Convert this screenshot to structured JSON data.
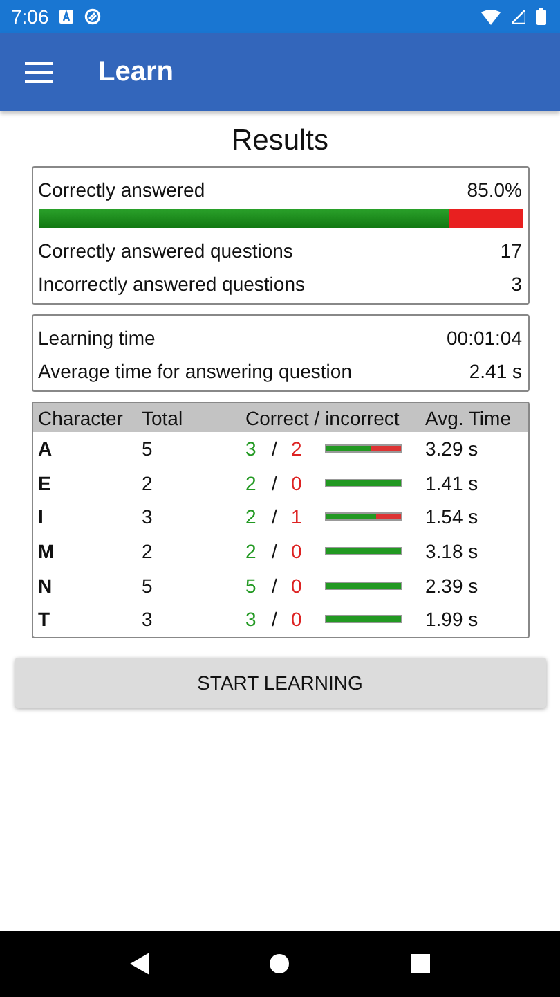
{
  "status_bar": {
    "time": "7:06"
  },
  "app_bar": {
    "title": "Learn"
  },
  "title": "Results",
  "summary": {
    "label": "Correctly answered",
    "value": "85.0%",
    "level": 0.85,
    "rows": [
      {
        "label": "Correctly answered questions",
        "value": "17"
      },
      {
        "label": "Incorrectly answered questions",
        "value": "3"
      }
    ]
  },
  "timing": [
    {
      "label": "Learning time",
      "value": "00:01:04"
    },
    {
      "label": "Average time for answering question",
      "value": "2.41 s"
    }
  ],
  "table": {
    "columns": [
      "Character",
      "Total",
      "Correct / incorrect",
      "Avg. Time"
    ],
    "rows": [
      {
        "character": "A",
        "total": "5",
        "correct": "3",
        "separator": "/",
        "incorrect": "2",
        "level": 0.6,
        "time": "3.29 s"
      },
      {
        "character": "E",
        "total": "2",
        "correct": "2",
        "separator": "/",
        "incorrect": "0",
        "level": 1,
        "time": "1.41 s"
      },
      {
        "character": "I",
        "total": "3",
        "correct": "2",
        "separator": "/",
        "incorrect": "1",
        "level": 0.67,
        "time": "1.54 s"
      },
      {
        "character": "M",
        "total": "2",
        "correct": "2",
        "separator": "/",
        "incorrect": "0",
        "level": 1,
        "time": "3.18 s"
      },
      {
        "character": "N",
        "total": "5",
        "correct": "5",
        "separator": "/",
        "incorrect": "0",
        "level": 1,
        "time": "2.39 s"
      },
      {
        "character": "T",
        "total": "3",
        "correct": "3",
        "separator": "/",
        "incorrect": "0",
        "level": 1,
        "time": "1.99 s"
      }
    ]
  },
  "button": "START LEARNING"
}
